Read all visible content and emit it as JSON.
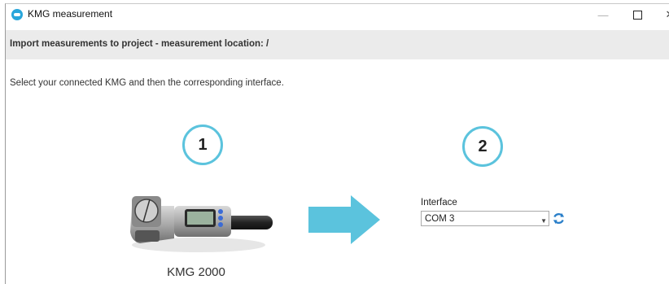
{
  "window": {
    "title": "KMG measurement",
    "controls": {
      "minimize": "—",
      "close": "✕"
    }
  },
  "header": {
    "text": "Import measurements to project - measurement location:  /"
  },
  "instruction": "Select your connected KMG and then the corresponding interface.",
  "steps": [
    {
      "number": "1"
    },
    {
      "number": "2"
    }
  ],
  "device": {
    "name": "KMG 2000"
  },
  "interface": {
    "label": "Interface",
    "selected": "COM 3",
    "icons": {
      "dropdown": "chevron-down-icon",
      "refresh": "refresh-icon"
    }
  },
  "colors": {
    "accent": "#5bc3dd",
    "header_band": "#ebebeb",
    "app_icon": "#29a6db"
  }
}
